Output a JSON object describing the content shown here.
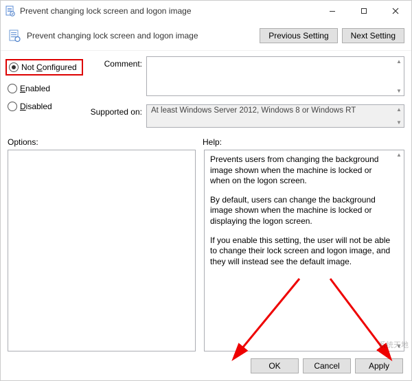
{
  "window": {
    "title": "Prevent changing lock screen and logon image"
  },
  "toolbar": {
    "policy_name": "Prevent changing lock screen and logon image",
    "previous_label": "Previous Setting",
    "next_label": "Next Setting"
  },
  "radios": {
    "not_configured": "Not Configured",
    "enabled": "Enabled",
    "disabled": "Disabled"
  },
  "fields": {
    "comment_label": "Comment:",
    "comment_value": "",
    "supported_label": "Supported on:",
    "supported_value": "At least Windows Server 2012, Windows 8 or Windows RT"
  },
  "lower": {
    "options_label": "Options:",
    "help_label": "Help:",
    "help_p1": "Prevents users from changing the background image shown when the machine is locked or when on the logon screen.",
    "help_p2": "By default, users can change the background image shown when the machine is locked or displaying the logon screen.",
    "help_p3": "If you enable this setting, the user will not be able to change their lock screen and logon image, and they will instead see the default image."
  },
  "buttons": {
    "ok": "OK",
    "cancel": "Cancel",
    "apply": "Apply"
  },
  "watermark": "系统天地"
}
